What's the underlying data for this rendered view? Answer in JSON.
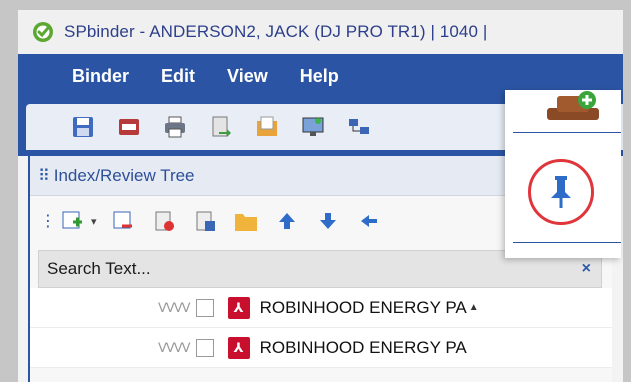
{
  "window": {
    "title": "SPbinder - ANDERSON2, JACK (DJ PRO TR1) | 1040 |"
  },
  "menu": {
    "items": [
      "Binder",
      "Edit",
      "View",
      "Help"
    ]
  },
  "panel": {
    "title": "Index/Review Tree",
    "search_placeholder": "Search Text...",
    "search_clear": "×"
  },
  "tree": {
    "rows": [
      {
        "label": "ROBINHOOD ENERGY PA"
      },
      {
        "label": "ROBINHOOD ENERGY PA"
      }
    ]
  },
  "colors": {
    "menu_blue": "#2b55a4",
    "pdf_red": "#c8102e",
    "highlight_circle": "#e0363b"
  },
  "icons": {
    "app": "check-circle-icon",
    "pin": "pin-icon"
  }
}
